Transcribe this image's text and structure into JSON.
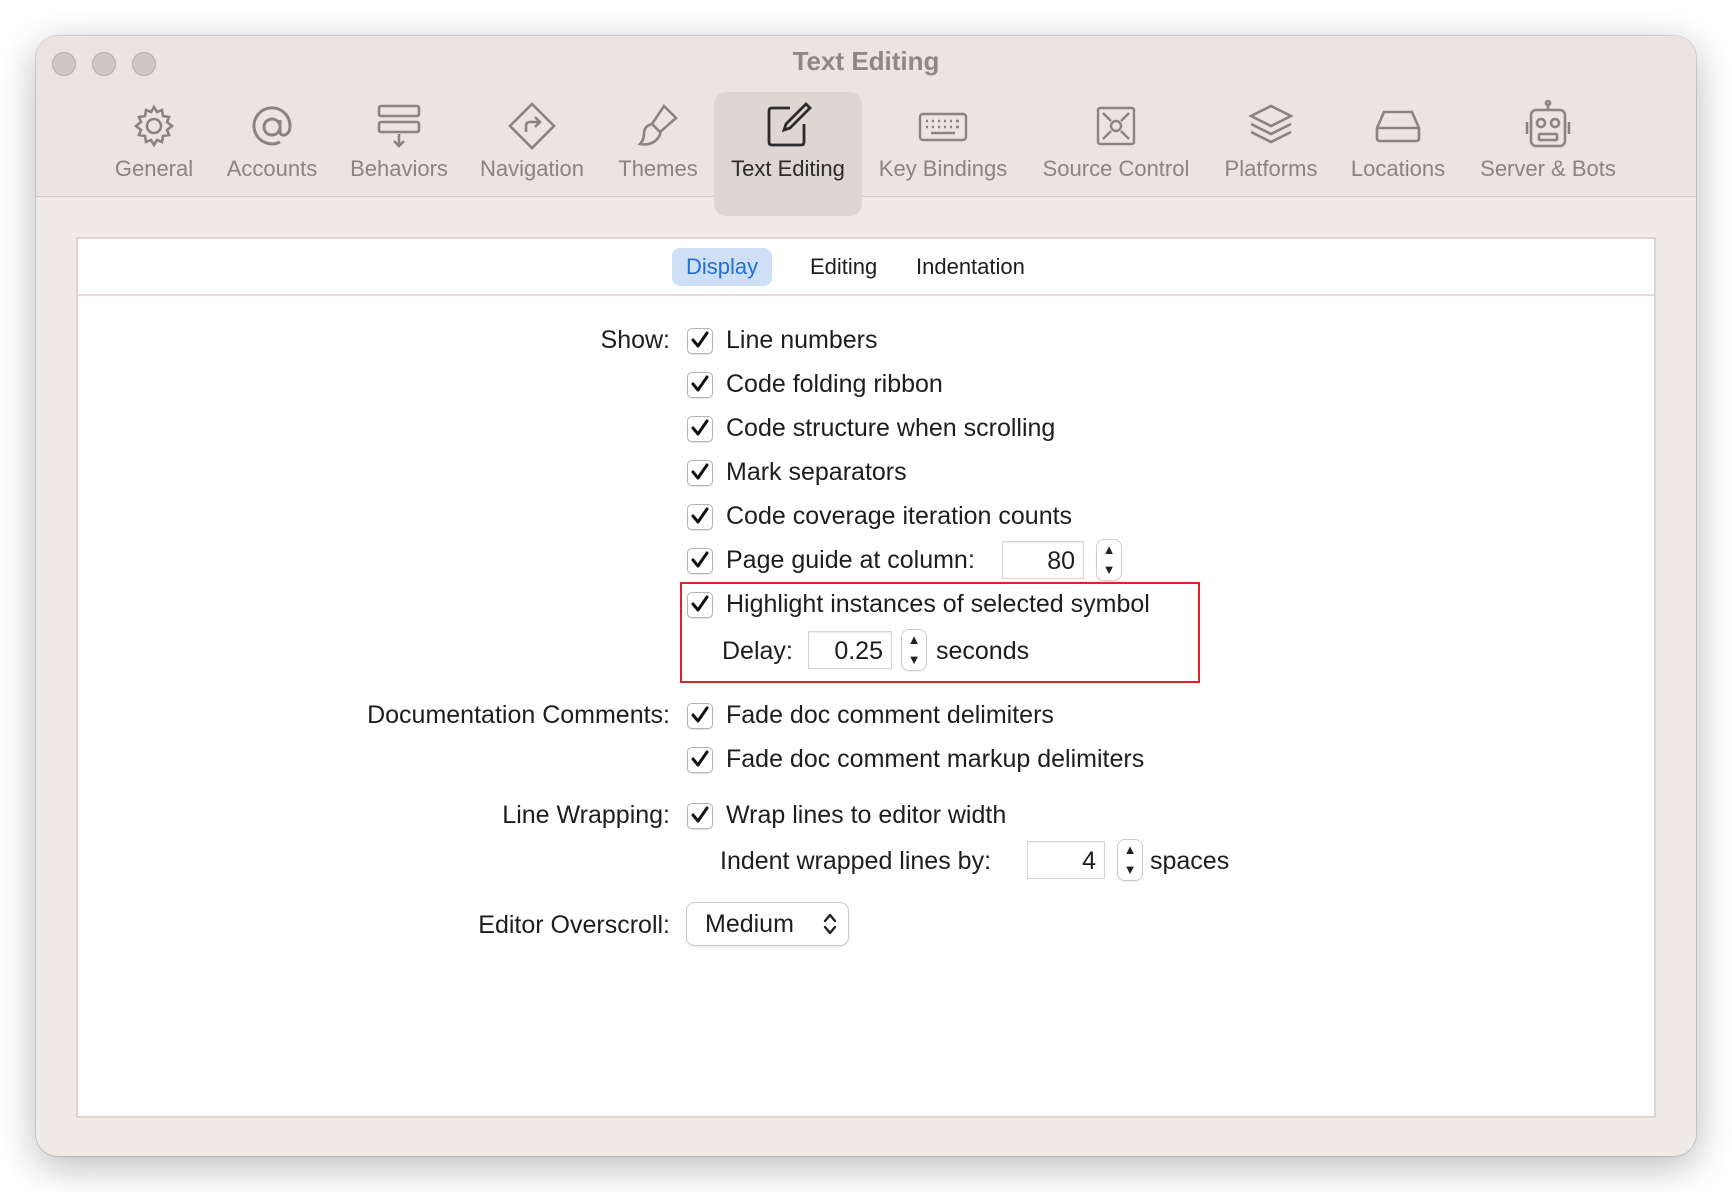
{
  "window": {
    "title": "Text Editing"
  },
  "toolbar": {
    "items": [
      {
        "label": "General",
        "icon": "gear-icon"
      },
      {
        "label": "Accounts",
        "icon": "at-sign-icon"
      },
      {
        "label": "Behaviors",
        "icon": "behaviors-icon"
      },
      {
        "label": "Navigation",
        "icon": "navigation-icon"
      },
      {
        "label": "Themes",
        "icon": "paintbrush-icon"
      },
      {
        "label": "Text Editing",
        "icon": "square-pencil-icon",
        "selected": true
      },
      {
        "label": "Key Bindings",
        "icon": "keyboard-icon"
      },
      {
        "label": "Source Control",
        "icon": "source-control-icon"
      },
      {
        "label": "Platforms",
        "icon": "stack-icon"
      },
      {
        "label": "Locations",
        "icon": "drive-icon"
      },
      {
        "label": "Server & Bots",
        "icon": "robot-icon"
      }
    ]
  },
  "tabs": [
    {
      "label": "Display",
      "active": true
    },
    {
      "label": "Editing",
      "active": false
    },
    {
      "label": "Indentation",
      "active": false
    }
  ],
  "show": {
    "label": "Show:",
    "options": [
      {
        "label": "Line numbers",
        "checked": true
      },
      {
        "label": "Code folding ribbon",
        "checked": true
      },
      {
        "label": "Code structure when scrolling",
        "checked": true
      },
      {
        "label": "Mark separators",
        "checked": true
      },
      {
        "label": "Code coverage iteration counts",
        "checked": true
      },
      {
        "label": "Page guide at column:",
        "checked": true
      },
      {
        "label": "Highlight instances of selected symbol",
        "checked": true
      }
    ],
    "page_guide_value": "80",
    "delay_label": "Delay:",
    "delay_value": "0.25",
    "delay_unit": "seconds"
  },
  "documentation": {
    "label": "Documentation Comments:",
    "options": [
      {
        "label": "Fade doc comment delimiters",
        "checked": true
      },
      {
        "label": "Fade doc comment markup delimiters",
        "checked": true
      }
    ]
  },
  "wrapping": {
    "label": "Line Wrapping:",
    "option": {
      "label": "Wrap lines to editor width",
      "checked": true
    },
    "indent_label": "Indent wrapped lines by:",
    "indent_value": "4",
    "indent_unit": "spaces"
  },
  "overscroll": {
    "label": "Editor Overscroll:",
    "value": "Medium"
  },
  "colors": {
    "accent": "#1f6fd6",
    "tab_active_bg": "#cfe0f6",
    "highlight_border": "#e0202c",
    "window_bg": "#f1ebe8"
  }
}
